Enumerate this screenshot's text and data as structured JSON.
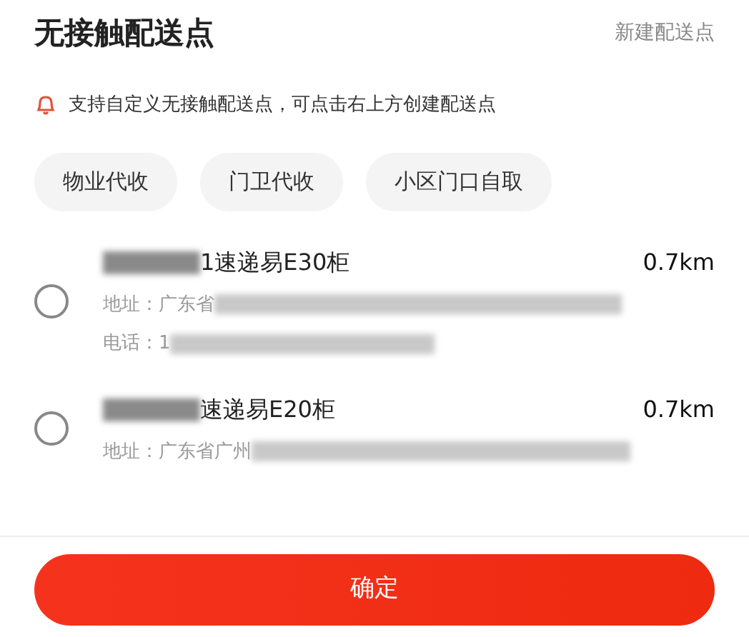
{
  "header": {
    "title": "无接触配送点",
    "action": "新建配送点"
  },
  "notice": "支持自定义无接触配送点，可点击右上方创建配送点",
  "chips": [
    {
      "label": "物业代收",
      "selected": false
    },
    {
      "label": "门卫代收",
      "selected": false
    },
    {
      "label": "小区门口自取",
      "selected": false
    }
  ],
  "items": [
    {
      "name": "1速递易E30柜",
      "distance": "0.7km",
      "address": "地址：广东省",
      "phone": "电话：1",
      "selected": false
    },
    {
      "name": "速递易E20柜",
      "distance": "0.7km",
      "address": "地址：广东省广州",
      "selected": false
    }
  ],
  "confirm": "确定"
}
